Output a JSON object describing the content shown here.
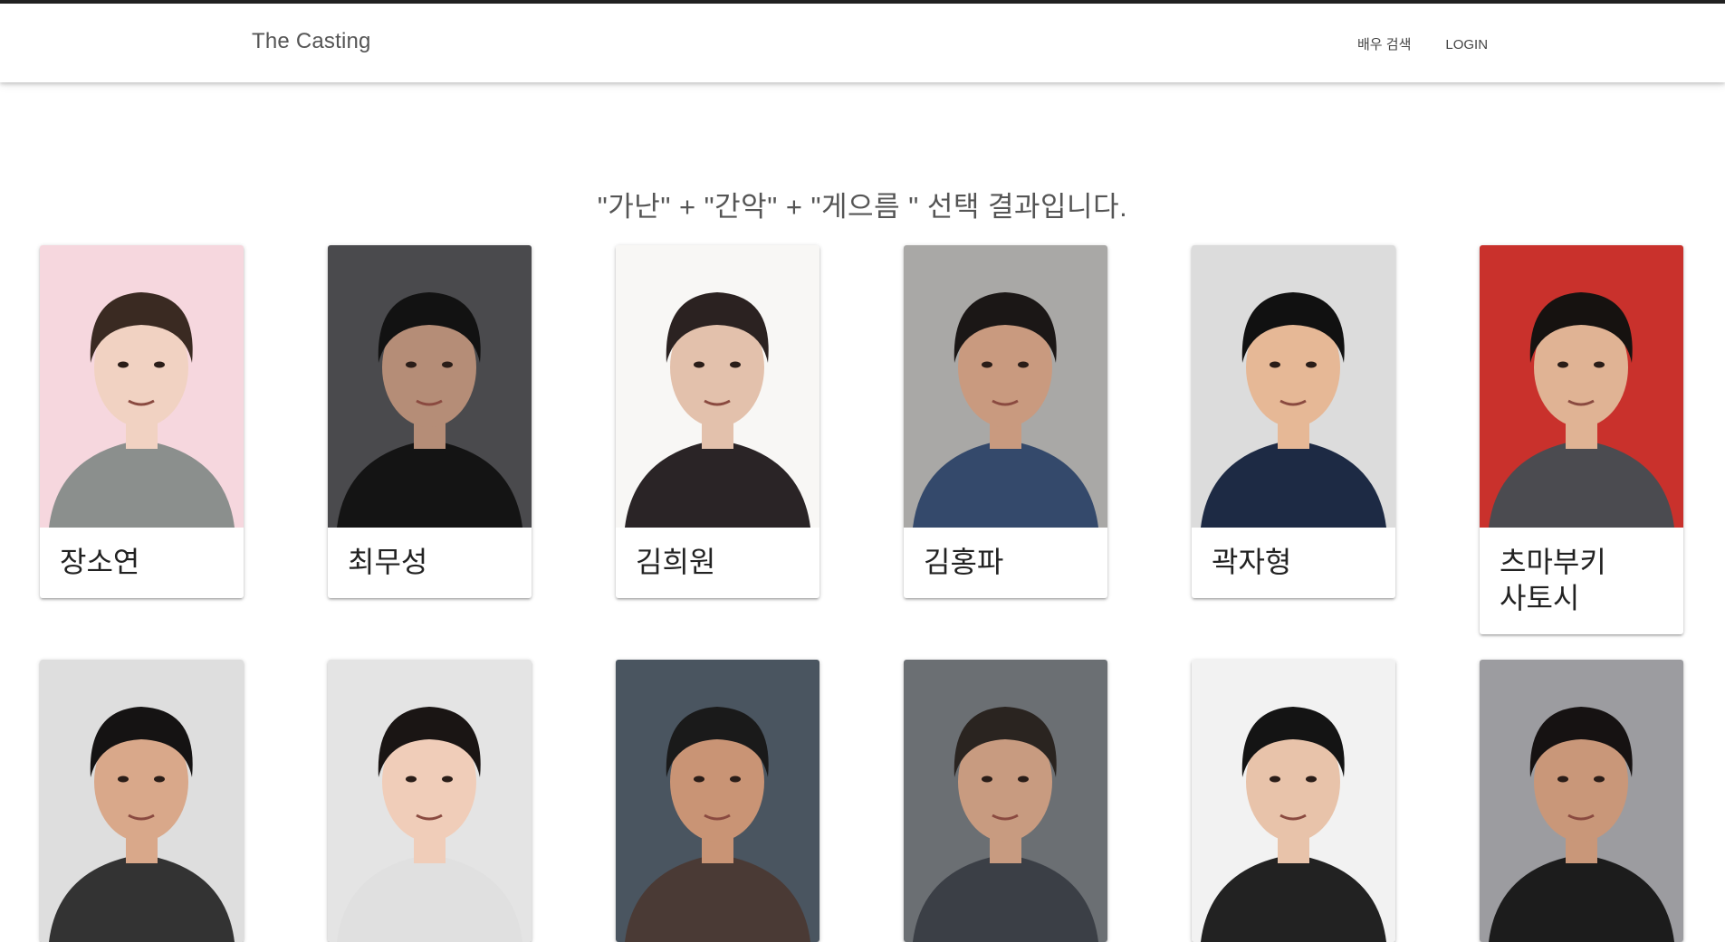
{
  "header": {
    "brand": "The Casting",
    "nav": [
      {
        "label": "배우 검색"
      },
      {
        "label": "LOGIN"
      }
    ]
  },
  "main": {
    "result_heading": "\"가난\" + \"간악\" + \"게으름 \" 선택 결과입니다."
  },
  "actors": [
    {
      "name": "장소연",
      "bg": "#f6d7de",
      "hair": "#3a2a22",
      "skin": "#f1d2c2",
      "cloth": "#8b8f8d"
    },
    {
      "name": "최무성",
      "bg": "#4a4a4d",
      "hair": "#121212",
      "skin": "#b58d77",
      "cloth": "#141414"
    },
    {
      "name": "김희원",
      "bg": "#f8f7f5",
      "hair": "#2b2221",
      "skin": "#e3c1ac",
      "cloth": "#2a2426"
    },
    {
      "name": "김홍파",
      "bg": "#a9a8a6",
      "hair": "#1b1716",
      "skin": "#c99a7f",
      "cloth": "#34496b"
    },
    {
      "name": "곽자형",
      "bg": "#dcdcdc",
      "hair": "#111111",
      "skin": "#e6b896",
      "cloth": "#1d2a44"
    },
    {
      "name": "츠마부키 사토시",
      "bg": "#c9312c",
      "hair": "#161210",
      "skin": "#e0b394",
      "cloth": "#4b4b50"
    },
    {
      "name": "",
      "bg": "#dedede",
      "hair": "#151313",
      "skin": "#d9a88a",
      "cloth": "#333333"
    },
    {
      "name": "",
      "bg": "#e4e4e4",
      "hair": "#1a1514",
      "skin": "#f0cdb9",
      "cloth": "#e0e0e0"
    },
    {
      "name": "",
      "bg": "#4a5560",
      "hair": "#1a1a1a",
      "skin": "#c99475",
      "cloth": "#4a3a35"
    },
    {
      "name": "",
      "bg": "#6b6f73",
      "hair": "#2a2420",
      "skin": "#c89b80",
      "cloth": "#3b3f46"
    },
    {
      "name": "",
      "bg": "#f2f2f2",
      "hair": "#141414",
      "skin": "#e8c3aa",
      "cloth": "#222222"
    },
    {
      "name": "",
      "bg": "#9c9ca0",
      "hair": "#161212",
      "skin": "#c99779",
      "cloth": "#1c1c1c"
    }
  ]
}
